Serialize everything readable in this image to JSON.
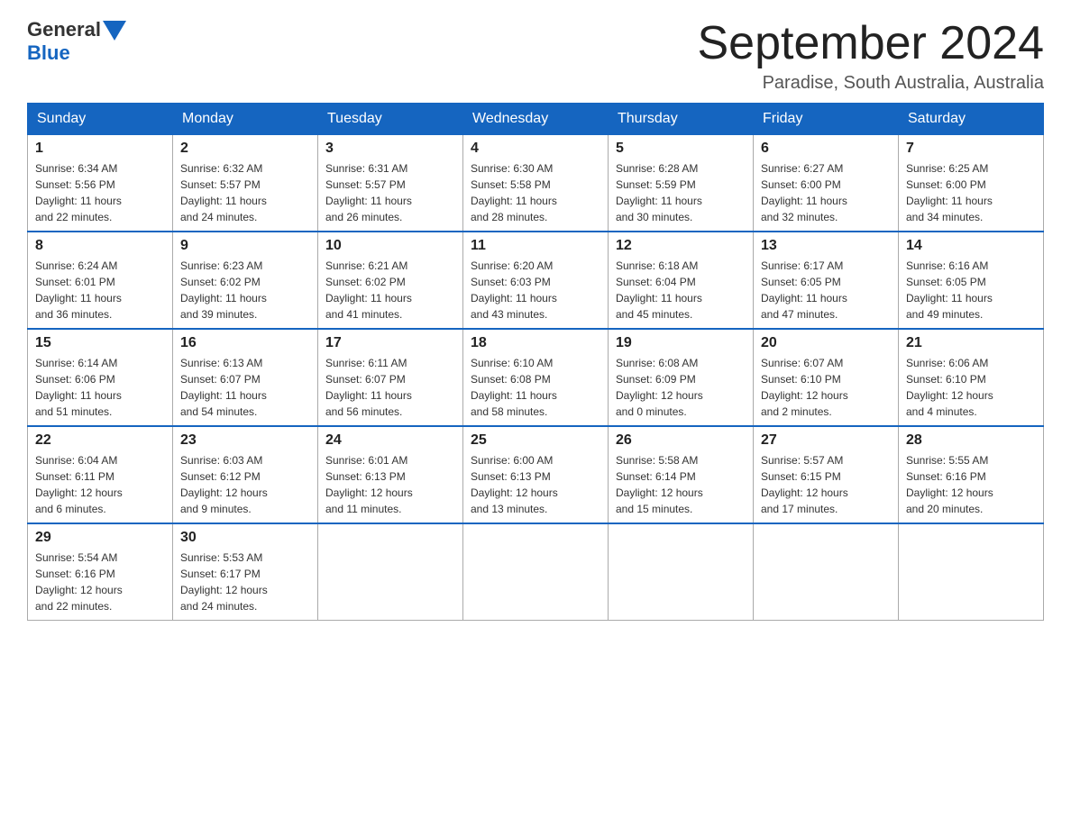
{
  "logo": {
    "general": "General",
    "blue": "Blue"
  },
  "title": "September 2024",
  "location": "Paradise, South Australia, Australia",
  "weekdays": [
    "Sunday",
    "Monday",
    "Tuesday",
    "Wednesday",
    "Thursday",
    "Friday",
    "Saturday"
  ],
  "weeks": [
    [
      {
        "day": "1",
        "sunrise": "6:34 AM",
        "sunset": "5:56 PM",
        "daylight": "11 hours and 22 minutes."
      },
      {
        "day": "2",
        "sunrise": "6:32 AM",
        "sunset": "5:57 PM",
        "daylight": "11 hours and 24 minutes."
      },
      {
        "day": "3",
        "sunrise": "6:31 AM",
        "sunset": "5:57 PM",
        "daylight": "11 hours and 26 minutes."
      },
      {
        "day": "4",
        "sunrise": "6:30 AM",
        "sunset": "5:58 PM",
        "daylight": "11 hours and 28 minutes."
      },
      {
        "day": "5",
        "sunrise": "6:28 AM",
        "sunset": "5:59 PM",
        "daylight": "11 hours and 30 minutes."
      },
      {
        "day": "6",
        "sunrise": "6:27 AM",
        "sunset": "6:00 PM",
        "daylight": "11 hours and 32 minutes."
      },
      {
        "day": "7",
        "sunrise": "6:25 AM",
        "sunset": "6:00 PM",
        "daylight": "11 hours and 34 minutes."
      }
    ],
    [
      {
        "day": "8",
        "sunrise": "6:24 AM",
        "sunset": "6:01 PM",
        "daylight": "11 hours and 36 minutes."
      },
      {
        "day": "9",
        "sunrise": "6:23 AM",
        "sunset": "6:02 PM",
        "daylight": "11 hours and 39 minutes."
      },
      {
        "day": "10",
        "sunrise": "6:21 AM",
        "sunset": "6:02 PM",
        "daylight": "11 hours and 41 minutes."
      },
      {
        "day": "11",
        "sunrise": "6:20 AM",
        "sunset": "6:03 PM",
        "daylight": "11 hours and 43 minutes."
      },
      {
        "day": "12",
        "sunrise": "6:18 AM",
        "sunset": "6:04 PM",
        "daylight": "11 hours and 45 minutes."
      },
      {
        "day": "13",
        "sunrise": "6:17 AM",
        "sunset": "6:05 PM",
        "daylight": "11 hours and 47 minutes."
      },
      {
        "day": "14",
        "sunrise": "6:16 AM",
        "sunset": "6:05 PM",
        "daylight": "11 hours and 49 minutes."
      }
    ],
    [
      {
        "day": "15",
        "sunrise": "6:14 AM",
        "sunset": "6:06 PM",
        "daylight": "11 hours and 51 minutes."
      },
      {
        "day": "16",
        "sunrise": "6:13 AM",
        "sunset": "6:07 PM",
        "daylight": "11 hours and 54 minutes."
      },
      {
        "day": "17",
        "sunrise": "6:11 AM",
        "sunset": "6:07 PM",
        "daylight": "11 hours and 56 minutes."
      },
      {
        "day": "18",
        "sunrise": "6:10 AM",
        "sunset": "6:08 PM",
        "daylight": "11 hours and 58 minutes."
      },
      {
        "day": "19",
        "sunrise": "6:08 AM",
        "sunset": "6:09 PM",
        "daylight": "12 hours and 0 minutes."
      },
      {
        "day": "20",
        "sunrise": "6:07 AM",
        "sunset": "6:10 PM",
        "daylight": "12 hours and 2 minutes."
      },
      {
        "day": "21",
        "sunrise": "6:06 AM",
        "sunset": "6:10 PM",
        "daylight": "12 hours and 4 minutes."
      }
    ],
    [
      {
        "day": "22",
        "sunrise": "6:04 AM",
        "sunset": "6:11 PM",
        "daylight": "12 hours and 6 minutes."
      },
      {
        "day": "23",
        "sunrise": "6:03 AM",
        "sunset": "6:12 PM",
        "daylight": "12 hours and 9 minutes."
      },
      {
        "day": "24",
        "sunrise": "6:01 AM",
        "sunset": "6:13 PM",
        "daylight": "12 hours and 11 minutes."
      },
      {
        "day": "25",
        "sunrise": "6:00 AM",
        "sunset": "6:13 PM",
        "daylight": "12 hours and 13 minutes."
      },
      {
        "day": "26",
        "sunrise": "5:58 AM",
        "sunset": "6:14 PM",
        "daylight": "12 hours and 15 minutes."
      },
      {
        "day": "27",
        "sunrise": "5:57 AM",
        "sunset": "6:15 PM",
        "daylight": "12 hours and 17 minutes."
      },
      {
        "day": "28",
        "sunrise": "5:55 AM",
        "sunset": "6:16 PM",
        "daylight": "12 hours and 20 minutes."
      }
    ],
    [
      {
        "day": "29",
        "sunrise": "5:54 AM",
        "sunset": "6:16 PM",
        "daylight": "12 hours and 22 minutes."
      },
      {
        "day": "30",
        "sunrise": "5:53 AM",
        "sunset": "6:17 PM",
        "daylight": "12 hours and 24 minutes."
      },
      null,
      null,
      null,
      null,
      null
    ]
  ],
  "labels": {
    "sunrise": "Sunrise:",
    "sunset": "Sunset:",
    "daylight": "Daylight:"
  }
}
